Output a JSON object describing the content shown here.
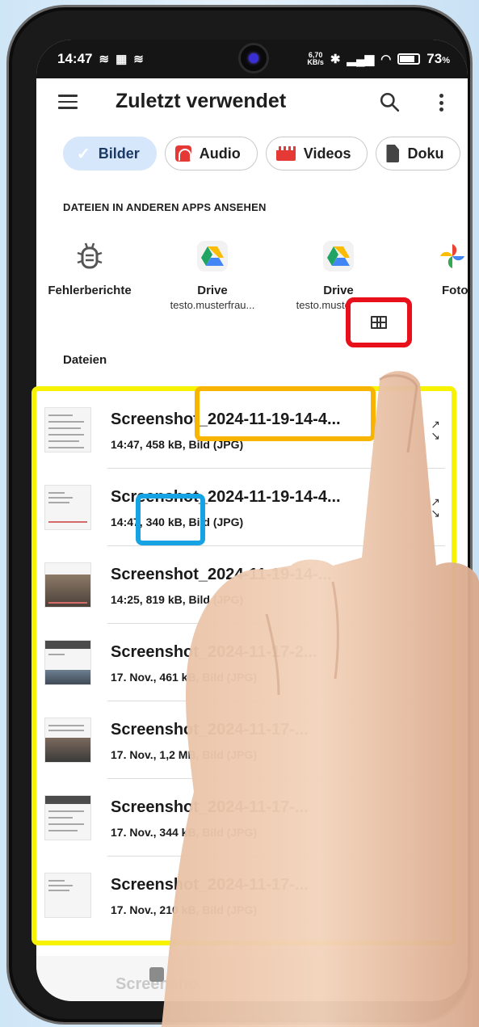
{
  "status_bar": {
    "time": "14:47",
    "net_speed_value": "6,70",
    "net_speed_unit": "KB/s",
    "battery": "73",
    "battery_unit": "%"
  },
  "app_bar": {
    "title": "Zuletzt verwendet"
  },
  "chips": [
    {
      "label": "Bilder",
      "icon": "check-icon",
      "selected": true
    },
    {
      "label": "Audio",
      "icon": "headphones-icon",
      "selected": false
    },
    {
      "label": "Videos",
      "icon": "clapperboard-icon",
      "selected": false
    },
    {
      "label": "Doku",
      "icon": "document-icon",
      "selected": false
    }
  ],
  "other_apps": {
    "heading": "DATEIEN IN ANDEREN APPS ANSEHEN",
    "items": [
      {
        "name": "Fehlerberichte",
        "sub": "",
        "icon": "bug-icon"
      },
      {
        "name": "Drive",
        "sub": "testo.musterfrau...",
        "icon": "google-drive-icon"
      },
      {
        "name": "Drive",
        "sub": "testo.musterfrau...",
        "icon": "google-drive-icon"
      },
      {
        "name": "Foto",
        "sub": "",
        "icon": "google-photos-icon"
      }
    ]
  },
  "files": {
    "heading": "Dateien",
    "view_toggle_icon": "grid-view-icon",
    "items": [
      {
        "name": "Screenshot_2024-11-19-14-4...",
        "meta": "14:47, 458 kB, Bild (JPG)"
      },
      {
        "name": "Screenshot_2024-11-19-14-4...",
        "meta": "14:47, 340 kB, Bild (JPG)"
      },
      {
        "name": "Screenshot_2024-11-19-14-...",
        "meta": "14:25, 819 kB, Bild (JPG)"
      },
      {
        "name": "Screenshot_2024-11-17-2...",
        "meta": "17. Nov., 461 kB, Bild (JPG)"
      },
      {
        "name": "Screenshot_2024-11-17-...",
        "meta": "17. Nov., 1,2 MB, Bild (JPG)"
      },
      {
        "name": "Screenshot_2024-11-17-...",
        "meta": "17. Nov., 344 kB, Bild (JPG)"
      },
      {
        "name": "Screenshot_2024-11-17-...",
        "meta": "17. Nov., 210 kB, Bild (JPG)"
      }
    ],
    "partial_next": "Screensho"
  },
  "highlights": {
    "orange_text": "_2024-11-19-14-4...",
    "blue_text": "340 kB,"
  },
  "colors": {
    "highlight_red": "#e8101a",
    "highlight_yellow": "#f7f300",
    "highlight_orange": "#f7b400",
    "highlight_blue": "#16a3e4",
    "chip_selected": "#d6e6fb"
  }
}
